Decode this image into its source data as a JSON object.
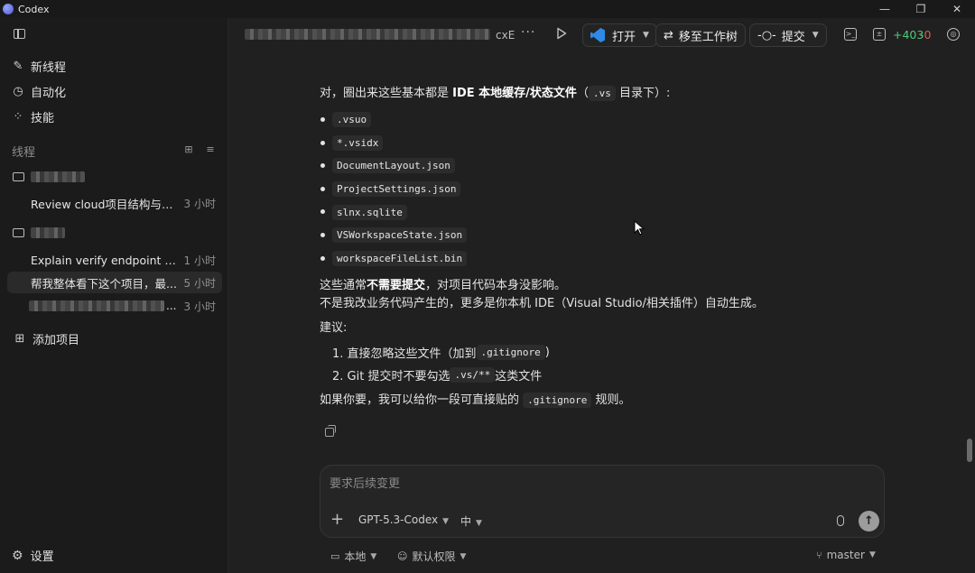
{
  "window": {
    "title": "Codex",
    "controls": [
      "—",
      "❐",
      "✕"
    ]
  },
  "sidebar": {
    "nav": [
      {
        "label": "新线程",
        "icon": "compose-icon"
      },
      {
        "label": "自动化",
        "icon": "clock-icon"
      },
      {
        "label": "技能",
        "icon": "skills-icon"
      }
    ],
    "section_label": "线程",
    "groups": [
      {
        "threads": [
          {
            "title": "Review cloud项目结构与业务",
            "time": "3 小时"
          }
        ]
      },
      {
        "threads": [
          {
            "title": "Explain verify endpoint data...",
            "time": "1 小时"
          },
          {
            "title": "帮我整体看下这个项目，最...",
            "time": "5 小时",
            "active": true
          },
          {
            "title": "...",
            "time": "3 小时"
          }
        ]
      }
    ],
    "add_project": "添加项目",
    "settings": "设置"
  },
  "topbar": {
    "crumb_suffix": "cxE",
    "open_label": "打开",
    "move_label": "移至工作树",
    "commit_label": "提交",
    "diff_add": "+403",
    "diff_del": "-0"
  },
  "message": {
    "intro_pre": "对，圈出来这些基本都是 ",
    "intro_bold": "IDE 本地缓存/状态文件",
    "intro_mid": "（",
    "intro_code": ".vs",
    "intro_post": " 目录下）:",
    "files": [
      ".vsuo",
      "*.vsidx",
      "DocumentLayout.json",
      "ProjectSettings.json",
      "slnx.sqlite",
      "VSWorkspaceState.json",
      "workspaceFileList.bin"
    ],
    "note1_pre": "这些通常",
    "note1_bold": "不需要提交",
    "note1_post": "，对项目代码本身没影响。",
    "note2": "不是我改业务代码产生的，更多是你本机 IDE（Visual Studio/相关插件）自动生成。",
    "suggest_label": "建议:",
    "step1_pre": "1. 直接忽略这些文件（加到 ",
    "step1_code": ".gitignore",
    "step1_post": " )",
    "step2_pre": "2. Git 提交时不要勾选 ",
    "step2_code": ".vs/**",
    "step2_post": " 这类文件",
    "closing_pre": "如果你要，我可以给你一段可直接贴的 ",
    "closing_code": ".gitignore",
    "closing_post": " 规则。"
  },
  "composer": {
    "placeholder": "要求后续变更",
    "model": "GPT-5.3-Codex",
    "effort": "中"
  },
  "footer": {
    "location": "本地",
    "permissions": "默认权限",
    "branch": "master"
  }
}
